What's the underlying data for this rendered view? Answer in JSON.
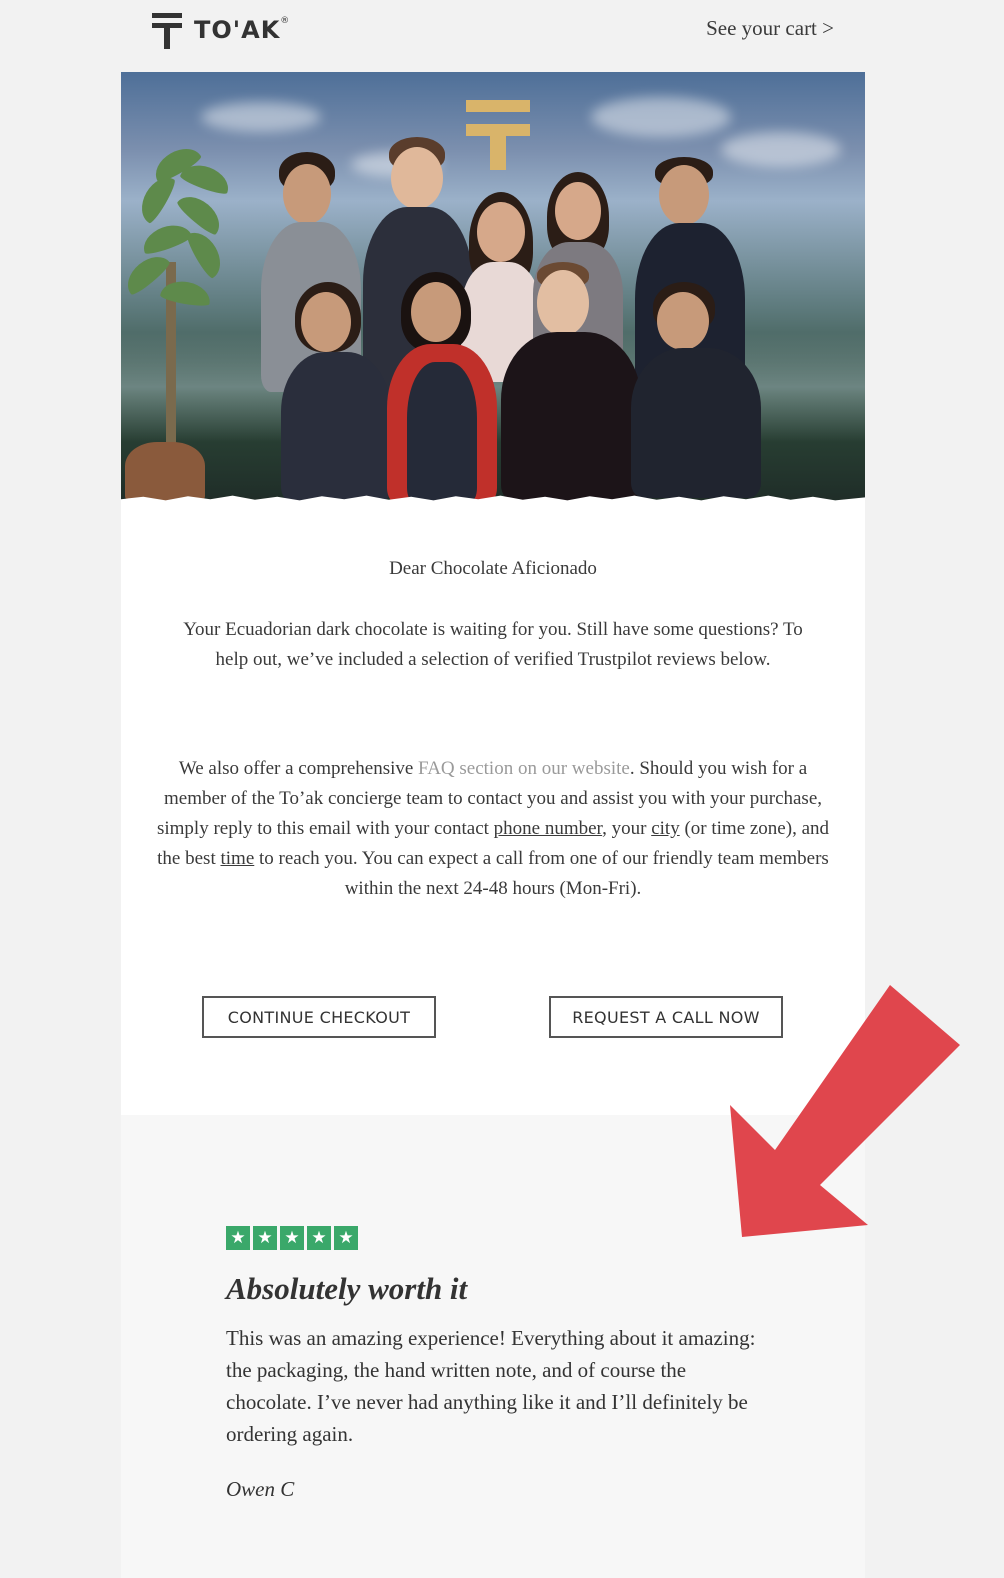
{
  "header": {
    "brand": "TO'AK",
    "cart_link": "See your cart >"
  },
  "hero": {
    "alt": "To'ak team photo"
  },
  "content": {
    "greeting": "Dear Chocolate Aficionado",
    "intro": "Your Ecuadorian dark chocolate is waiting for you. Still have some questions? To help out, we’ve included a selection of verified Trustpilot reviews below.",
    "faq_pre": "We also offer a comprehensive ",
    "faq_link": "FAQ section on our website",
    "faq_mid1": ". Should you wish for a member of the To’ak concierge team to contact you and assist you with your purchase, simply reply to this email with your contact ",
    "phone_number": "phone number",
    "faq_mid2": ", your ",
    "city": "city",
    "faq_mid3": " (or time zone), and the best ",
    "time": "time",
    "faq_post": " to reach you. You can expect a call from one of our friendly team members within the next 24-48 hours (Mon-Fri)."
  },
  "buttons": {
    "continue_checkout": "CONTINUE CHECKOUT",
    "request_call": "REQUEST A CALL NOW"
  },
  "review": {
    "rating": 5,
    "star_glyph": "★",
    "star_color": "#3aa86a",
    "title": "Absolutely worth it",
    "body": "This was an amazing experience! Everything about it amazing: the packaging, the hand written note, and of course the chocolate. I’ve never had anything like it and I’ll definitely be ordering again.",
    "author": "Owen C"
  },
  "annotation": {
    "arrow_color": "#e0464d",
    "icon": "arrow-down-left-icon"
  }
}
